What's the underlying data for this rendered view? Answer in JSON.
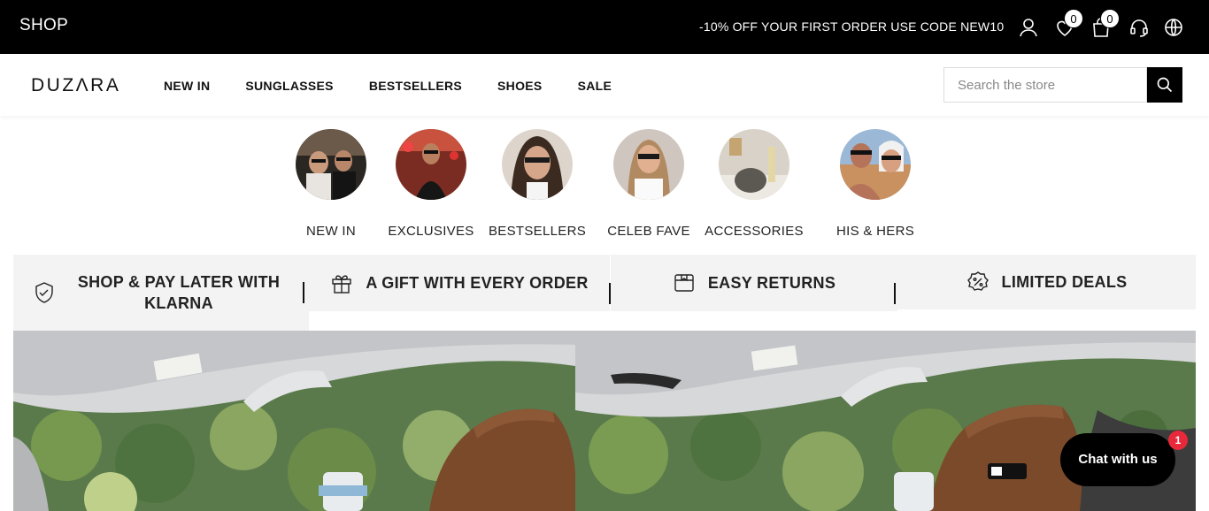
{
  "topbar": {
    "shop_label": "SHOP",
    "promo": "-10% OFF YOUR FIRST ORDER USE CODE NEW10",
    "wishlist_count": "0",
    "cart_count": "0",
    "icons": [
      "user-icon",
      "heart-icon",
      "bag-icon",
      "headset-icon",
      "globe-icon"
    ]
  },
  "header": {
    "logo": "DUZΛRA",
    "nav": [
      "NEW IN",
      "SUNGLASSES",
      "BESTSELLERS",
      "SHOES",
      "SALE"
    ],
    "search_placeholder": "Search the store"
  },
  "categories": [
    {
      "label": "NEW IN"
    },
    {
      "label": "EXCLUSIVES"
    },
    {
      "label": "BESTSELLERS"
    },
    {
      "label": "CELEB FAVE"
    },
    {
      "label": "ACCESSORIES"
    },
    {
      "label": "HIS & HERS"
    }
  ],
  "features": {
    "klarna": "SHOP & PAY LATER WITH KLARNA",
    "gift": "A GIFT WITH EVERY ORDER",
    "returns": "EASY RETURNS",
    "deals": "LIMITED DEALS"
  },
  "chat": {
    "label": "Chat with us",
    "badge": "1"
  }
}
